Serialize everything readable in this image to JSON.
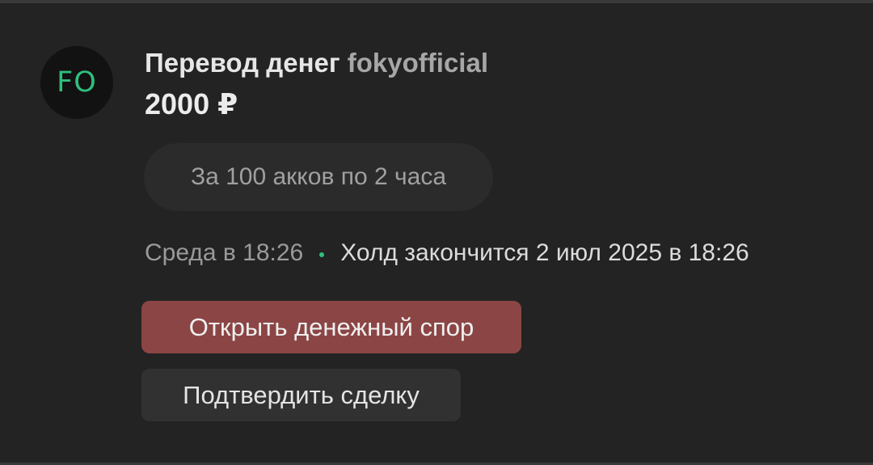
{
  "avatar": {
    "initials": "FO",
    "color": "#2fbf7d"
  },
  "transfer": {
    "title": "Перевод денег",
    "username": "fokyofficial",
    "amount": "2000 ₽"
  },
  "comment": {
    "text": "За 100 акков по 2 часа"
  },
  "meta": {
    "time": "Среда в 18:26",
    "hold": "Холд закончится 2 июл 2025 в 18:26",
    "status_dot_color": "#2fbf7d"
  },
  "actions": {
    "dispute_label": "Открыть денежный спор",
    "dispute_color": "#8c4545",
    "confirm_label": "Подтвердить сделку"
  }
}
